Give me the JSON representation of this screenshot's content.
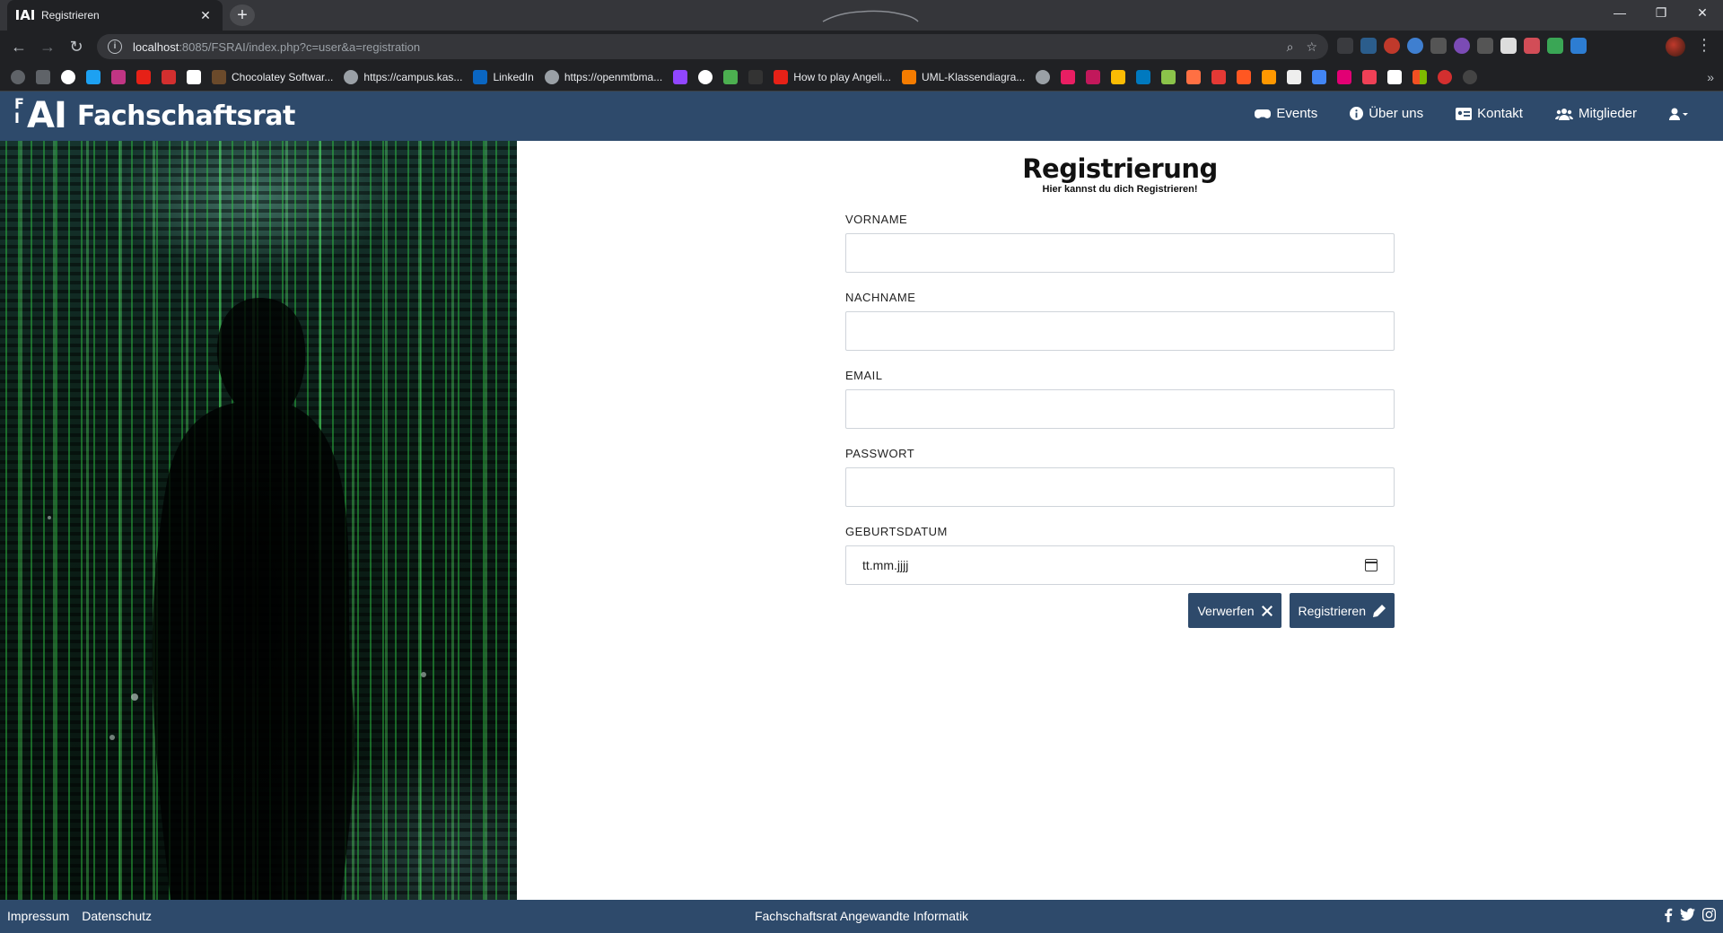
{
  "browser": {
    "tab_title": "Registrieren",
    "tab_favicon": "IAI",
    "url_host": "localhost",
    "url_rest": ":8085/FSRAI/index.php?c=user&a=registration",
    "bookmarks": [
      "Chocolatey Softwar...",
      "https://campus.kas...",
      "LinkedIn",
      "https://openmtbma...",
      "How to play Angeli...",
      "UML-Klassendiagra..."
    ]
  },
  "header": {
    "brand_text": "Fachschaftsrat",
    "nav": {
      "events": "Events",
      "about": "Über uns",
      "contact": "Kontakt",
      "members": "Mitglieder"
    }
  },
  "form": {
    "title": "Registrierung",
    "subtitle": "Hier kannst du dich Registrieren!",
    "fields": {
      "vorname": {
        "label": "VORNAME",
        "value": ""
      },
      "nachname": {
        "label": "NACHNAME",
        "value": ""
      },
      "email": {
        "label": "EMAIL",
        "value": ""
      },
      "passwort": {
        "label": "PASSWORT",
        "value": ""
      },
      "geburtsdatum": {
        "label": "GEBURTSDATUM",
        "value": "tt.mm.jjjj"
      }
    },
    "discard_label": "Verwerfen",
    "register_label": "Registrieren"
  },
  "footer": {
    "impressum": "Impressum",
    "datenschutz": "Datenschutz",
    "center_text": "Fachschaftsrat Angewandte Informatik"
  },
  "colors": {
    "brand": "#2e4a6b",
    "chrome_dark": "#202124"
  }
}
